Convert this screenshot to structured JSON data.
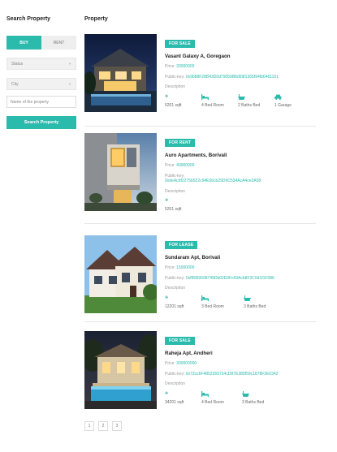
{
  "sidebar": {
    "title": "Search Property",
    "buy_label": "BUY",
    "rent_label": "RENT",
    "status_placeholder": "Status",
    "city_placeholder": "City",
    "name_placeholder": "Name of the property",
    "search_label": "Search Property"
  },
  "main": {
    "title": "Property"
  },
  "properties": [
    {
      "badge": "FOR SALE",
      "name": "Vasant Galaxy A, Goregaon",
      "price_label": "Price:",
      "price": "30000000",
      "key_label": "Public-key:",
      "key": "0x9b88F28B43D0d79059B8d59f1365f94fb6461101",
      "description_label": "Description",
      "area": "5201 sqft",
      "bedrooms": "4 Bed Room",
      "baths": "2 Baths Bed",
      "garage": "1 Garage"
    },
    {
      "badge": "FOR RENT",
      "name": "Auro Apartments, Borivali",
      "price_label": "Price:",
      "price": "40000000",
      "key_label": "Public-key:",
      "key": "0xdeAcdf2275b522c94E56cb29D9C534AcA4ce2A08",
      "description_label": "Description",
      "area": "5201 sqft"
    },
    {
      "badge": "FOR LEASE",
      "name": "Sundaram Apt, Borivali",
      "price_label": "Price:",
      "price": "15000000",
      "key_label": "Public-key:",
      "key": "0xf85B9598749Db02E9Fc69Acb8F3C0d1f1F086",
      "description_label": "Description",
      "area": "12201 sqft",
      "bedrooms": "3 Bed Room",
      "baths": "3 Baths Bed"
    },
    {
      "badge": "FOR SALE",
      "name": "Raheja Apt, Andheri",
      "price_label": "Price:",
      "price": "300000000",
      "key_label": "Public-key:",
      "key": "0x72cc6F4852265734cD87E380f59c1878F2E0342",
      "description_label": "Description",
      "area": "34201 sqft",
      "bedrooms": "4 Bed Room",
      "baths": "3 Baths Bed"
    }
  ],
  "pagination": [
    "1",
    "2",
    "3"
  ],
  "colors": {
    "accent": "#2bbbad",
    "divider": "#e6e6e6"
  },
  "icons": {
    "area": "arrows-move-icon",
    "bed": "bed-icon",
    "bath": "bathtub-icon",
    "garage": "car-icon"
  }
}
